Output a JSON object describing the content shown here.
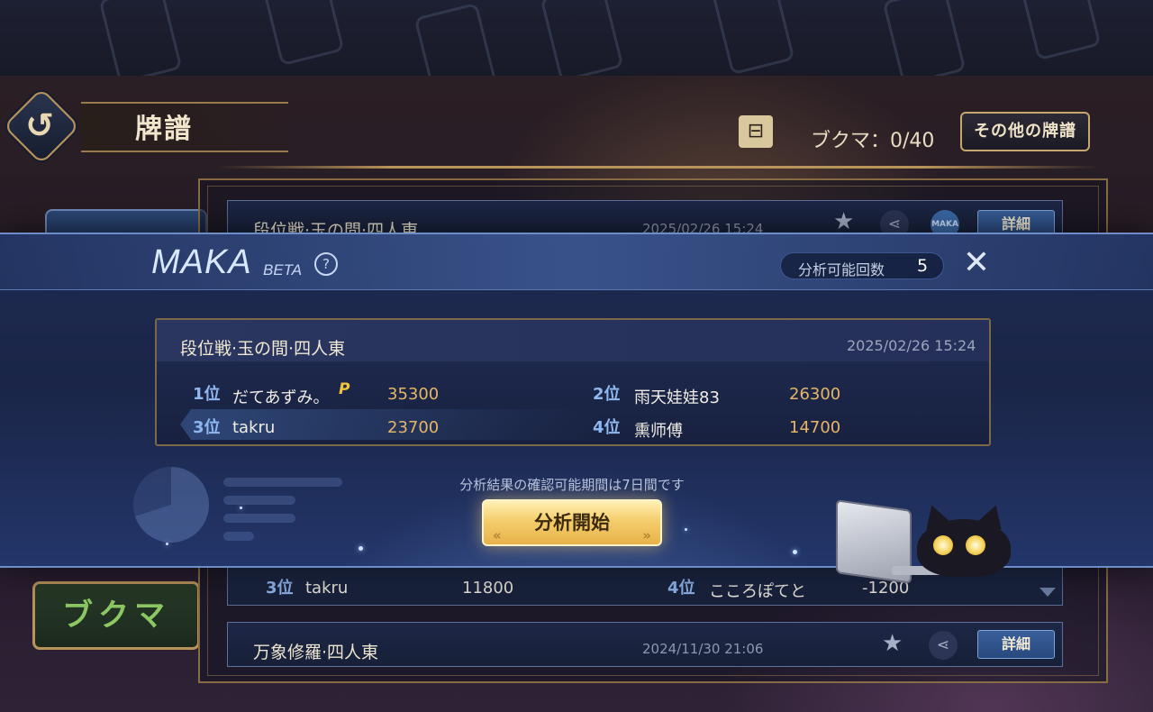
{
  "header": {
    "back_icon_glyph": "↺",
    "title": "牌譜",
    "filter_icon_glyph": "⊟",
    "bookmark_count": "ブクマ：0/40",
    "other_records_button": "その他の牌譜"
  },
  "side_tabs": {
    "bookmark_tab": "ブクマ"
  },
  "records": [
    {
      "title": "段位戦·玉の間·四人東",
      "datetime": "2025/02/26 15:24",
      "maka_icon_label": "MAKA",
      "detail_button": "詳細"
    },
    {
      "players_visible": [
        {
          "rank": "3位",
          "name": "takru",
          "score": "11800"
        },
        {
          "rank": "4位",
          "name": "こころぽてと",
          "score": "-1200"
        }
      ]
    },
    {
      "title": "万象修羅·四人東",
      "datetime": "2024/11/30 21:06",
      "detail_button": "詳細"
    }
  ],
  "icons": {
    "star_glyph": "★",
    "share_glyph": "⋖",
    "close_glyph": "✕",
    "help_glyph": "?"
  },
  "modal": {
    "logo": "MAKA",
    "beta": "BETA",
    "analysis_count_label": "分析可能回数",
    "analysis_count_value": "5",
    "match": {
      "title": "段位戦·玉の間·四人東",
      "datetime": "2025/02/26 15:24",
      "players": [
        {
          "rank": "1位",
          "name": "だてあずみ。",
          "badge": "P",
          "score": "35300"
        },
        {
          "rank": "2位",
          "name": "雨天娃娃83",
          "score": "26300"
        },
        {
          "rank": "3位",
          "name": "takru",
          "score": "23700"
        },
        {
          "rank": "4位",
          "name": "熏师傅",
          "score": "14700"
        }
      ]
    },
    "notice": "分析結果の確認可能期間は7日間です",
    "start_button": "分析開始",
    "start_button_chevrons": {
      "left": "«",
      "right": "»"
    }
  },
  "colors": {
    "accent_gold": "#e1b568",
    "rank_blue": "#8fb8f0",
    "modal_bg": "#1e2b52",
    "button_gold": "#f4cd6c"
  }
}
